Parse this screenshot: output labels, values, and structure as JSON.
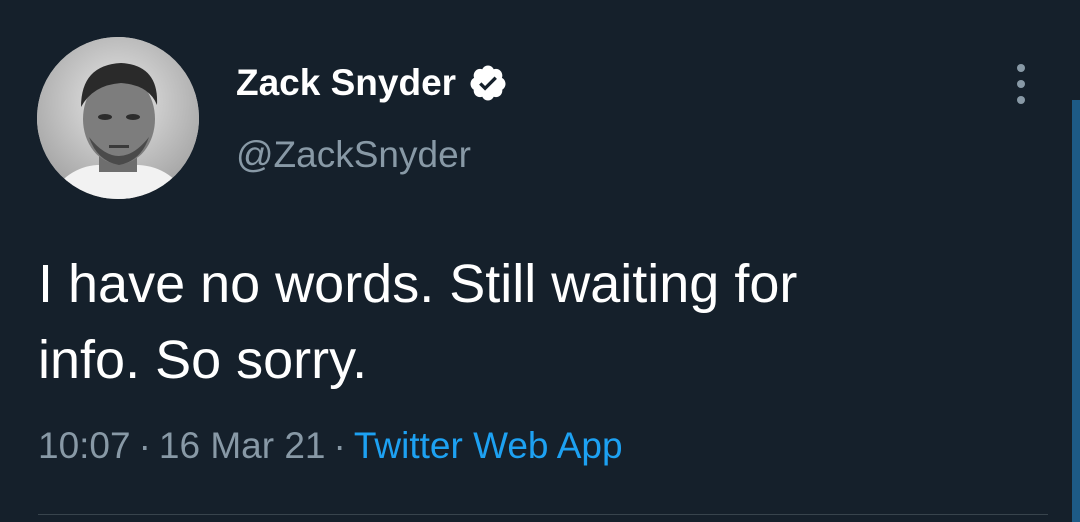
{
  "author": {
    "display_name": "Zack Snyder",
    "handle": "@ZackSnyder",
    "verified": true,
    "avatar_icon": "profile-photo"
  },
  "tweet": {
    "text": "I have no words. Still waiting for\ninfo. So sorry.",
    "time": "10:07",
    "date": "16 Mar 21",
    "separator": "·",
    "source": "Twitter Web App"
  },
  "icons": {
    "verified": "verified-badge-icon",
    "more": "more-vertical-icon"
  },
  "colors": {
    "background": "#15202b",
    "text_primary": "#ffffff",
    "text_secondary": "#8899a6",
    "link": "#1da1f2"
  }
}
